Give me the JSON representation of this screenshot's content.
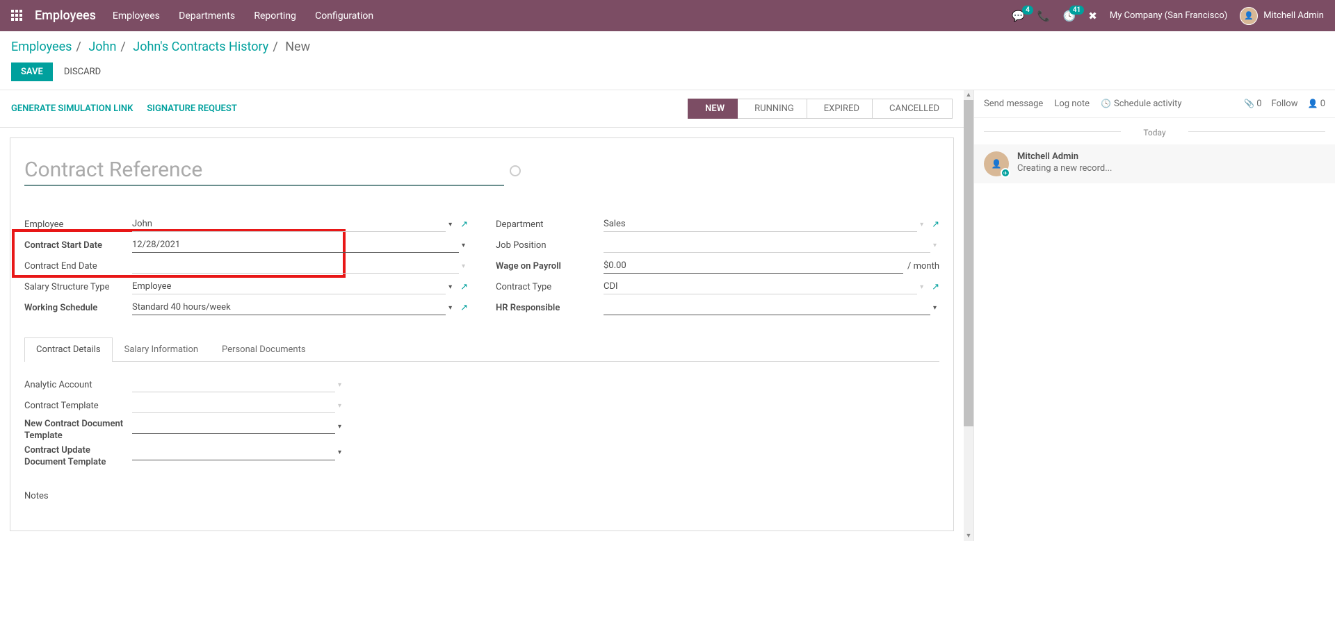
{
  "topbar": {
    "brand": "Employees",
    "nav": [
      "Employees",
      "Departments",
      "Reporting",
      "Configuration"
    ],
    "messages_badge": "4",
    "activities_badge": "41",
    "company": "My Company (San Francisco)",
    "user": "Mitchell Admin"
  },
  "breadcrumb": {
    "parts": [
      "Employees",
      "John",
      "John's Contracts History"
    ],
    "current": "New"
  },
  "buttons": {
    "save": "SAVE",
    "discard": "DISCARD"
  },
  "action_links": {
    "gen_sim": "GENERATE SIMULATION LINK",
    "sig_req": "SIGNATURE REQUEST"
  },
  "stages": [
    "NEW",
    "RUNNING",
    "EXPIRED",
    "CANCELLED"
  ],
  "title_placeholder": "Contract Reference",
  "fields": {
    "left": [
      {
        "label": "Employee",
        "value": "John",
        "ext": true,
        "bold": false
      },
      {
        "label": "Contract Start Date",
        "value": "12/28/2021",
        "ext": false,
        "bold": true
      },
      {
        "label": "Contract End Date",
        "value": "",
        "ext": false,
        "bold": false
      },
      {
        "label": "Salary Structure Type",
        "value": "Employee",
        "ext": true,
        "bold": false
      },
      {
        "label": "Working Schedule",
        "value": "Standard 40 hours/week",
        "ext": true,
        "bold": true
      }
    ],
    "right": [
      {
        "label": "Department",
        "value": "Sales",
        "ext": true,
        "unit": ""
      },
      {
        "label": "Job Position",
        "value": "",
        "ext": false,
        "unit": ""
      },
      {
        "label": "Wage on Payroll",
        "value": "$0.00",
        "ext": false,
        "unit": "/ month",
        "bold": true
      },
      {
        "label": "Contract Type",
        "value": "CDI",
        "ext": true,
        "unit": ""
      },
      {
        "label": "HR Responsible",
        "value": "",
        "ext": false,
        "unit": "",
        "bold": true
      }
    ]
  },
  "tabs": [
    "Contract Details",
    "Salary Information",
    "Personal Documents"
  ],
  "details_fields": [
    "Analytic Account",
    "Contract Template",
    "New Contract Document Template",
    "Contract Update Document Template"
  ],
  "notes_label": "Notes",
  "chatter": {
    "send": "Send message",
    "log": "Log note",
    "schedule": "Schedule activity",
    "attach_count": "0",
    "follow": "Follow",
    "follower_count": "0",
    "today": "Today",
    "msg_author": "Mitchell Admin",
    "msg_text": "Creating a new record..."
  }
}
